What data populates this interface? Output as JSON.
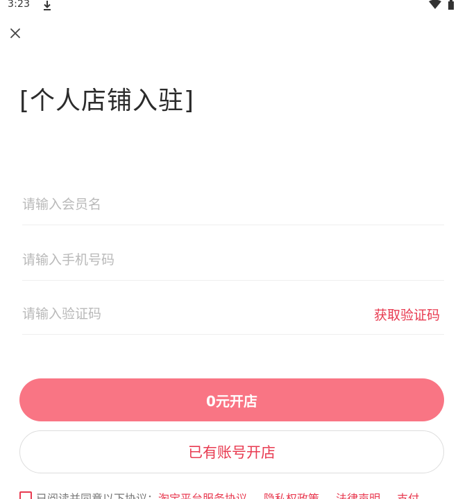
{
  "status_bar": {
    "time": "3:23",
    "download_icon": "download-icon",
    "wifi_icon": "wifi-icon",
    "battery_icon": "battery-icon"
  },
  "header": {
    "close_icon": "close-icon",
    "title": "[个人店铺入驻]"
  },
  "form": {
    "member_name": {
      "placeholder": "请输入会员名",
      "value": ""
    },
    "phone": {
      "placeholder": "请输入手机号码",
      "value": ""
    },
    "code": {
      "placeholder": "请输入验证码",
      "value": "",
      "get_code_label": "获取验证码"
    }
  },
  "buttons": {
    "open_shop_label": "0元开店",
    "existing_account_label": "已有账号开店"
  },
  "agreement": {
    "checked": false,
    "prefix": "已阅读并同意以下协议：",
    "links": [
      "淘宝平台服务协议",
      "隐私权政策",
      "法律声明",
      "支付"
    ]
  },
  "colors": {
    "accent": "#e83a50",
    "primary_button": "#f97584",
    "placeholder": "#b9b9b9",
    "divider": "#eeeeee"
  }
}
